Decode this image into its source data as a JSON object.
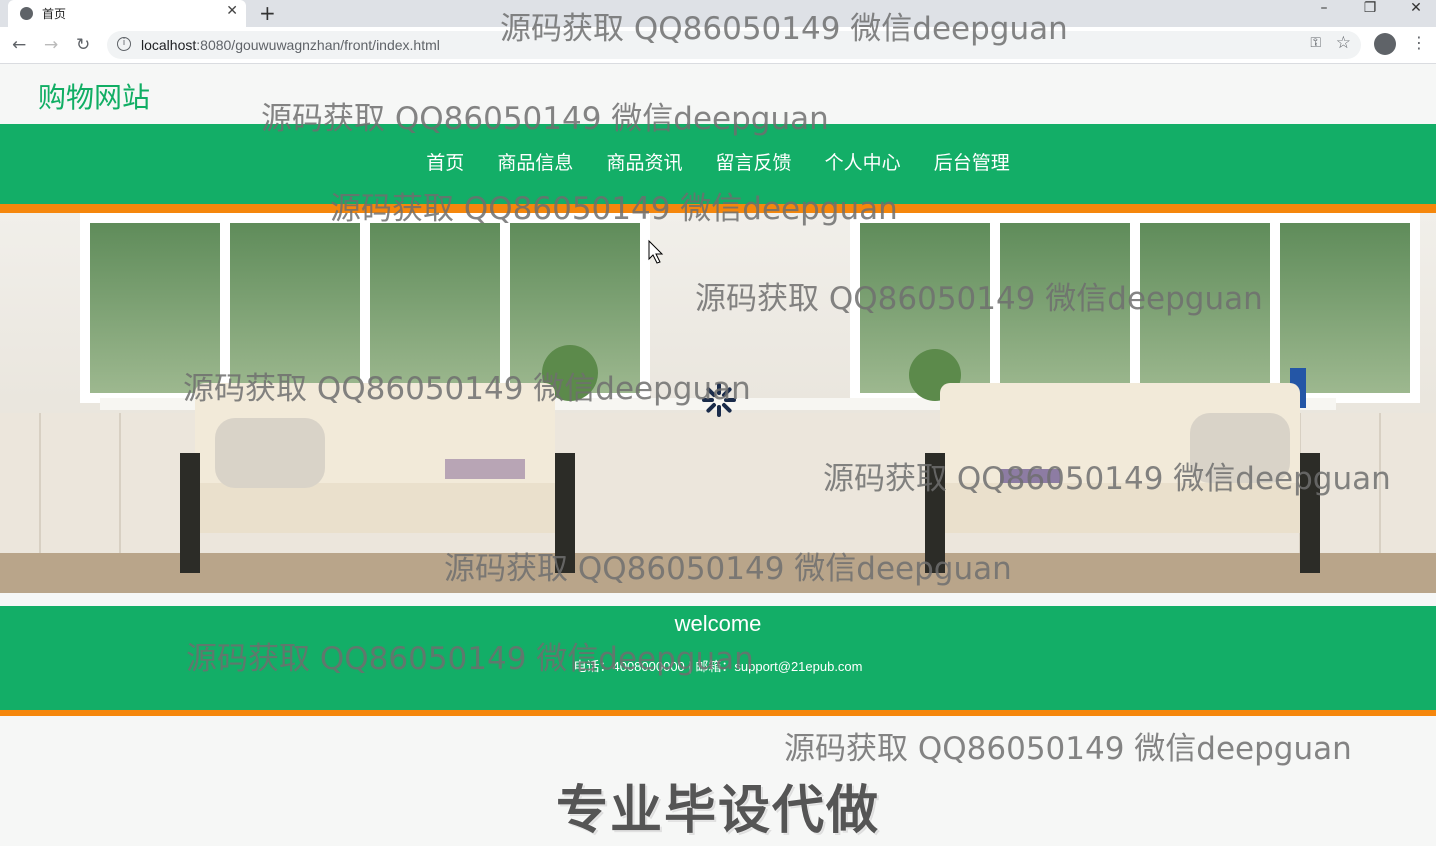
{
  "browser": {
    "tab_title": "首页",
    "tab_close": "✕",
    "new_tab": "+",
    "url_host": "localhost",
    "url_rest": ":8080/gouwuwagnzhan/front/index.html",
    "back": "←",
    "forward": "→",
    "reload": "↻",
    "key": "⚿",
    "star": "☆",
    "menu": "⋮",
    "minimize": "–",
    "restore": "❐",
    "close_window": "✕"
  },
  "site": {
    "brand": "购物网站",
    "nav": [
      "首页",
      "商品信息",
      "商品资讯",
      "留言反馈",
      "个人中心",
      "后台管理"
    ],
    "footer_title": "welcome",
    "contact": "电话：4008000000 | 邮箱：support@21epub.com",
    "promo": "专业毕设代做"
  },
  "watermark": "源码获取 QQ86050149 微信deepguan",
  "colors": {
    "primary": "#13ae67",
    "accent": "#f5870c",
    "brand_text": "#11ae64"
  }
}
